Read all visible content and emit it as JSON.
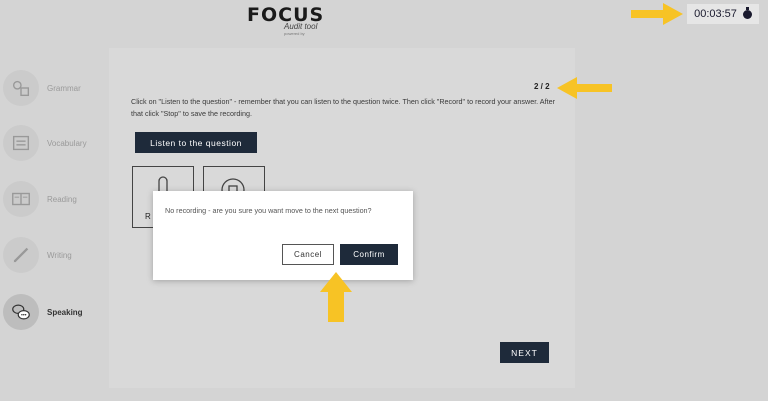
{
  "header": {
    "logo_main": "FOCUS",
    "logo_sub": "Audit tool",
    "logo_tiny": "powered by",
    "timer": "00:03:57"
  },
  "sidebar": {
    "items": [
      {
        "label": "Grammar",
        "icon": "grammar-icon",
        "active": false
      },
      {
        "label": "Vocabulary",
        "icon": "vocabulary-icon",
        "active": false
      },
      {
        "label": "Reading",
        "icon": "reading-icon",
        "active": false
      },
      {
        "label": "Writing",
        "icon": "writing-icon",
        "active": false
      },
      {
        "label": "Speaking",
        "icon": "speaking-icon",
        "active": true
      }
    ]
  },
  "main": {
    "counter": "2 / 2",
    "instructions": "Click on \"Listen to the question\" - remember that you can listen to the question twice. Then click \"Record\" to record your answer. After that click \"Stop\" to save the recording.",
    "listen_label": "Listen to the question",
    "record_label": "R",
    "next_label": "NEXT"
  },
  "modal": {
    "message": "No recording - are you sure you want move to the next question?",
    "cancel_label": "Cancel",
    "confirm_label": "Confirm"
  },
  "colors": {
    "accent": "#1e2a3a",
    "annotation_arrow": "#f7c325",
    "overlay": "#d4d4d4"
  }
}
